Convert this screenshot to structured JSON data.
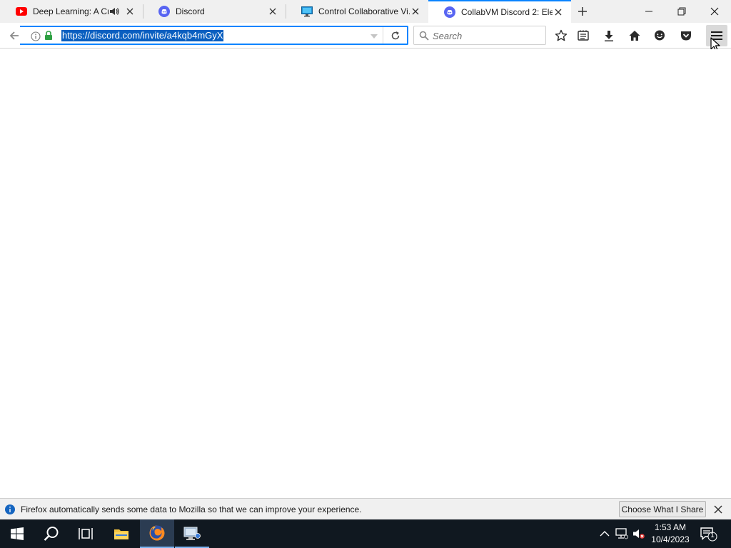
{
  "browser": {
    "tabs": [
      {
        "title": "Deep Learning: A Cr...",
        "icon": "youtube-icon",
        "audio": true,
        "active": false
      },
      {
        "title": "Discord",
        "icon": "discord-icon",
        "audio": false,
        "active": false
      },
      {
        "title": "Control Collaborative Vi...",
        "icon": "monitor-icon",
        "audio": false,
        "active": false
      },
      {
        "title": "CollabVM Discord 2: Ele...",
        "icon": "discord-icon",
        "audio": false,
        "active": true
      }
    ],
    "url": "https://discord.com/invite/a4kqb4mGyX",
    "search_placeholder": "Search",
    "toolbar_icons": [
      "star-icon",
      "reading-list-icon",
      "download-icon",
      "home-icon",
      "chat-icon",
      "pocket-icon",
      "menu-icon"
    ]
  },
  "notification": {
    "message": "Firefox automatically sends some data to Mozilla so that we can improve your experience.",
    "button_label": "Choose What I Share"
  },
  "taskbar": {
    "time": "1:53 AM",
    "date": "10/4/2023",
    "notification_count": "1"
  },
  "colors": {
    "accent": "#0a84ff",
    "url_highlight": "#0a5fc0",
    "taskbar": "#101820",
    "youtube_red": "#ff0000",
    "discord_blurple": "#5865f2"
  }
}
